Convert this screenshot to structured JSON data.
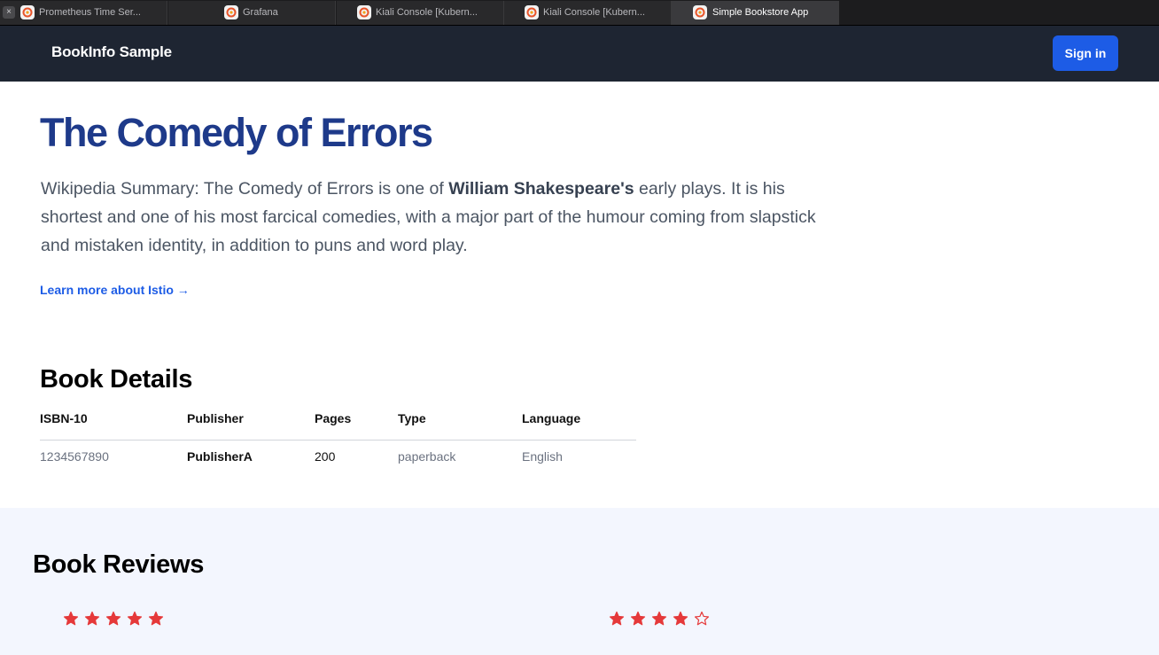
{
  "browser": {
    "tabs": [
      {
        "title": "Prometheus Time Ser...",
        "active": false
      },
      {
        "title": "Grafana",
        "active": false
      },
      {
        "title": "Kiali Console [Kubern...",
        "active": false
      },
      {
        "title": "Kiali Console [Kubern...",
        "active": false
      },
      {
        "title": "Simple Bookstore App",
        "active": true
      }
    ],
    "close_glyph": "×",
    "favicon_icon": "grafana-icon"
  },
  "header": {
    "brand": "BookInfo Sample",
    "sign_in_label": "Sign in"
  },
  "book": {
    "title": "The Comedy of Errors",
    "summary_prefix": "Wikipedia Summary: The Comedy of Errors is one of ",
    "summary_author": "William Shakespeare's",
    "summary_suffix": " early plays. It is his shortest and one of his most farcical comedies, with a major part of the humour coming from slapstick and mistaken identity, in addition to puns and word play.",
    "learn_more": "Learn more about Istio →"
  },
  "details": {
    "heading": "Book Details",
    "columns": [
      "ISBN-10",
      "Publisher",
      "Pages",
      "Type",
      "Language"
    ],
    "row": [
      "1234567890",
      "PublisherA",
      "200",
      "paperback",
      "English"
    ]
  },
  "reviews": {
    "heading": "Book Reviews",
    "items": [
      {
        "rating": 5,
        "max": 5
      },
      {
        "rating": 4,
        "max": 5
      }
    ]
  },
  "colors": {
    "title": "#1e3a8a",
    "accent": "#1d5ce6",
    "header_bg": "#1e2532",
    "star": "#e5393a",
    "reviews_bg": "#f3f6fe"
  }
}
